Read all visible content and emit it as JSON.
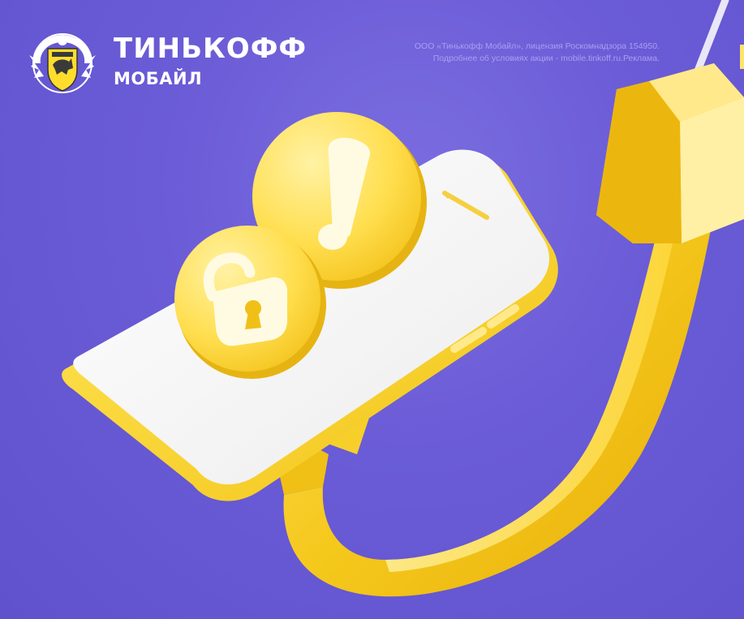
{
  "brand": {
    "name": "ТИНЬКОФФ",
    "sub": "МОБАЙЛ"
  },
  "legal": {
    "line1": "ООО «Тинькофф Мобайл», лицензия Роскомнадзора 154950.",
    "line2": "Подробнее об условиях акции - mobile.tinkoff.ru.Реклама."
  },
  "colors": {
    "background": "#6a5bd6",
    "accent_yellow": "#ffdd2d",
    "text": "#ffffff"
  },
  "icons": {
    "logo": "tinkoff-shield-emblem",
    "alert": "exclamation-icon",
    "lock": "unlocked-padlock-icon"
  }
}
